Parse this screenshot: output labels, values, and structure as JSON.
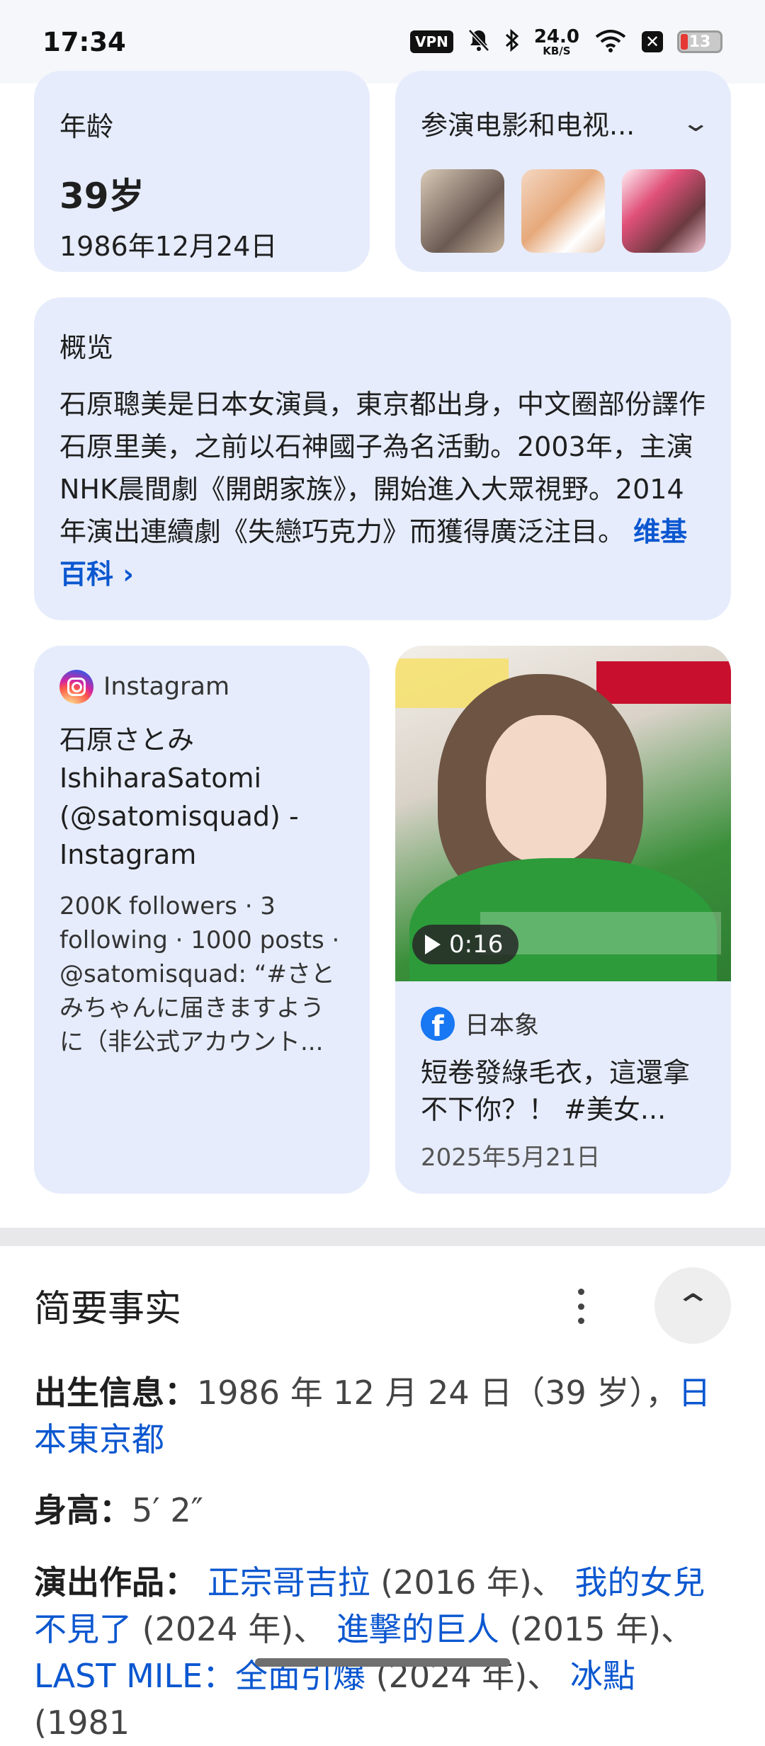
{
  "status_bar": {
    "time": "17:34",
    "vpn": "VPN",
    "speed_value": "24.0",
    "speed_unit": "KB/S",
    "battery": "13",
    "icons": [
      "vpn-icon",
      "mute-bell-icon",
      "bluetooth-icon",
      "wifi-icon",
      "x-app-icon",
      "battery-icon"
    ]
  },
  "age_card": {
    "title": "年龄",
    "value": "39岁",
    "birthdate": "1986年12月24日"
  },
  "films_card": {
    "title": "参演电影和电视...",
    "thumbnails": [
      "film-thumb-1",
      "film-thumb-2",
      "film-thumb-3"
    ]
  },
  "overview": {
    "title": "概览",
    "text": "石原聰美是日本女演員，東京都出身，中文圈部份譯作石原里美，之前以石神國子為名活動。2003年，主演NHK晨間劇《開朗家族》，開始進入大眾視野。2014年演出連續劇《失戀巧克力》而獲得廣泛注目。",
    "link": "维基百科 ›"
  },
  "instagram_card": {
    "source": "Instagram",
    "title": "石原さとみ IshiharaSatomi (@satomisquad) - Instagram",
    "description": "200K followers · 3 following · 1000 posts · @satomisquad: “#さとみちゃんに届きますように（非公式アカウント..."
  },
  "facebook_card": {
    "duration": "0:16",
    "source": "日本象",
    "title": "短卷發綠毛衣，這還拿不下你？！ #美女...",
    "date": "2025年5月21日"
  },
  "facts": {
    "title": "简要事实",
    "birth_label": "出生信息：",
    "birth_value": "1986 年 12 月 24 日（39 岁），",
    "birth_place": "日本東京都",
    "height_label": "身高：",
    "height_value": "5′ 2″",
    "works_label": "演出作品：",
    "works": [
      {
        "title": "正宗哥吉拉",
        "year": " (2016 年)、 "
      },
      {
        "title": "我的女兒不見了",
        "year": " (2024 年)、 "
      },
      {
        "title": "進擊的巨人",
        "year": " (2015 年)、"
      },
      {
        "title": "LAST MILE：全面引爆",
        "year": " (2024 年)、 "
      },
      {
        "title": "冰點",
        "year": " (1981"
      }
    ]
  },
  "colors": {
    "card_bg": "#e6ecfb",
    "link": "#0b57d0",
    "facebook": "#1877f2"
  }
}
